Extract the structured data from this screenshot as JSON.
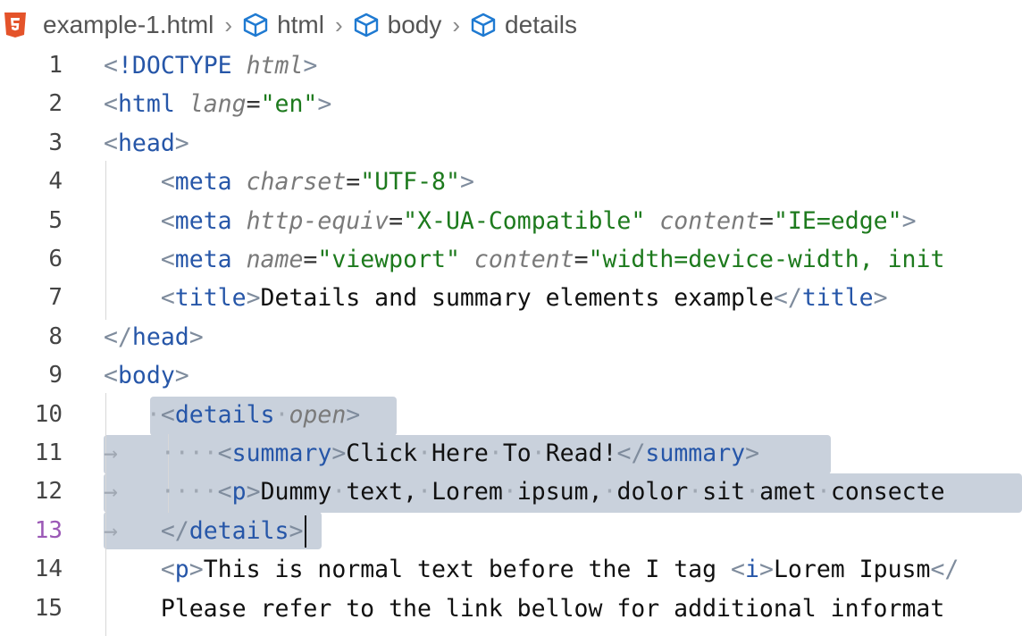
{
  "breadcrumb": {
    "file": "example-1.html",
    "items": [
      "html",
      "body",
      "details"
    ]
  },
  "editor": {
    "active_line": 13,
    "lines": [
      {
        "n": "1",
        "tokens": [
          [
            "b",
            "<"
          ],
          [
            "t",
            "!DOCTYPE"
          ],
          [
            "x",
            " "
          ],
          [
            "a",
            "html"
          ],
          [
            "b",
            ">"
          ]
        ]
      },
      {
        "n": "2",
        "tokens": [
          [
            "b",
            "<"
          ],
          [
            "t",
            "html"
          ],
          [
            "x",
            " "
          ],
          [
            "a",
            "lang"
          ],
          [
            "e",
            "="
          ],
          [
            "s",
            "\"en\""
          ],
          [
            "b",
            ">"
          ]
        ]
      },
      {
        "n": "3",
        "tokens": [
          [
            "b",
            "<"
          ],
          [
            "t",
            "head"
          ],
          [
            "b",
            ">"
          ]
        ]
      },
      {
        "n": "4",
        "tokens": [
          [
            "x",
            "    "
          ],
          [
            "b",
            "<"
          ],
          [
            "t",
            "meta"
          ],
          [
            "x",
            " "
          ],
          [
            "a",
            "charset"
          ],
          [
            "e",
            "="
          ],
          [
            "s",
            "\"UTF-8\""
          ],
          [
            "b",
            ">"
          ]
        ]
      },
      {
        "n": "5",
        "tokens": [
          [
            "x",
            "    "
          ],
          [
            "b",
            "<"
          ],
          [
            "t",
            "meta"
          ],
          [
            "x",
            " "
          ],
          [
            "a",
            "http-equiv"
          ],
          [
            "e",
            "="
          ],
          [
            "s",
            "\"X-UA-Compatible\""
          ],
          [
            "x",
            " "
          ],
          [
            "a",
            "content"
          ],
          [
            "e",
            "="
          ],
          [
            "s",
            "\"IE=edge\""
          ],
          [
            "b",
            ">"
          ]
        ]
      },
      {
        "n": "6",
        "tokens": [
          [
            "x",
            "    "
          ],
          [
            "b",
            "<"
          ],
          [
            "t",
            "meta"
          ],
          [
            "x",
            " "
          ],
          [
            "a",
            "name"
          ],
          [
            "e",
            "="
          ],
          [
            "s",
            "\"viewport\""
          ],
          [
            "x",
            " "
          ],
          [
            "a",
            "content"
          ],
          [
            "e",
            "="
          ],
          [
            "s",
            "\"width=device-width, init"
          ]
        ]
      },
      {
        "n": "7",
        "tokens": [
          [
            "x",
            "    "
          ],
          [
            "b",
            "<"
          ],
          [
            "t",
            "title"
          ],
          [
            "b",
            ">"
          ],
          [
            "x",
            "Details and summary elements example"
          ],
          [
            "b",
            "</"
          ],
          [
            "t",
            "title"
          ],
          [
            "b",
            ">"
          ]
        ]
      },
      {
        "n": "8",
        "tokens": [
          [
            "b",
            "</"
          ],
          [
            "t",
            "head"
          ],
          [
            "b",
            ">"
          ]
        ]
      },
      {
        "n": "9",
        "tokens": [
          [
            "b",
            "<"
          ],
          [
            "t",
            "body"
          ],
          [
            "b",
            ">"
          ]
        ]
      },
      {
        "n": "10",
        "tokens": [
          [
            "x",
            "   "
          ],
          [
            "w",
            "·"
          ],
          [
            "b",
            "<"
          ],
          [
            "t",
            "details"
          ],
          [
            "w",
            "·"
          ],
          [
            "a",
            "open"
          ],
          [
            "b",
            ">"
          ]
        ]
      },
      {
        "n": "11",
        "tokens": [
          [
            "w",
            "→   "
          ],
          [
            "w",
            "····"
          ],
          [
            "b",
            "<"
          ],
          [
            "t",
            "summary"
          ],
          [
            "b",
            ">"
          ],
          [
            "x",
            "Click"
          ],
          [
            "w",
            "·"
          ],
          [
            "x",
            "Here"
          ],
          [
            "w",
            "·"
          ],
          [
            "x",
            "To"
          ],
          [
            "w",
            "·"
          ],
          [
            "x",
            "Read!"
          ],
          [
            "b",
            "</"
          ],
          [
            "t",
            "summary"
          ],
          [
            "b",
            ">"
          ]
        ]
      },
      {
        "n": "12",
        "tokens": [
          [
            "w",
            "→   "
          ],
          [
            "w",
            "····"
          ],
          [
            "b",
            "<"
          ],
          [
            "t",
            "p"
          ],
          [
            "b",
            ">"
          ],
          [
            "x",
            "Dummy"
          ],
          [
            "w",
            "·"
          ],
          [
            "x",
            "text,"
          ],
          [
            "w",
            "·"
          ],
          [
            "x",
            "Lorem"
          ],
          [
            "w",
            "·"
          ],
          [
            "x",
            "ipsum,"
          ],
          [
            "w",
            "·"
          ],
          [
            "x",
            "dolor"
          ],
          [
            "w",
            "·"
          ],
          [
            "x",
            "sit"
          ],
          [
            "w",
            "·"
          ],
          [
            "x",
            "amet"
          ],
          [
            "w",
            "·"
          ],
          [
            "x",
            "consecte"
          ]
        ]
      },
      {
        "n": "13",
        "tokens": [
          [
            "w",
            "→   "
          ],
          [
            "b",
            "</"
          ],
          [
            "t",
            "details"
          ],
          [
            "b",
            ">"
          ]
        ]
      },
      {
        "n": "14",
        "tokens": [
          [
            "x",
            "    "
          ],
          [
            "b",
            "<"
          ],
          [
            "t",
            "p"
          ],
          [
            "b",
            ">"
          ],
          [
            "x",
            "This is normal text before the I tag "
          ],
          [
            "b",
            "<"
          ],
          [
            "t",
            "i"
          ],
          [
            "b",
            ">"
          ],
          [
            "x",
            "Lorem Ipusm"
          ],
          [
            "b",
            "</"
          ]
        ]
      },
      {
        "n": "15",
        "tokens": [
          [
            "x",
            "    Please refer to the link bellow for additional informat"
          ]
        ]
      }
    ]
  }
}
